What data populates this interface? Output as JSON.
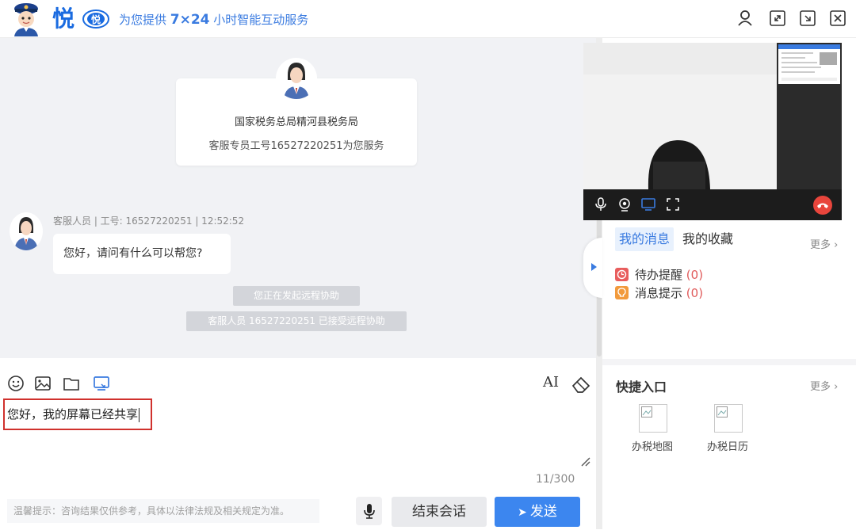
{
  "header": {
    "brand_char": "悦",
    "brand_badge": "悦",
    "slogan_prefix": "为您提供 ",
    "slogan_highlight": "7×24",
    "slogan_suffix": " 小时智能互动服务",
    "accent_color": "#1a6be0"
  },
  "chat": {
    "card": {
      "org": "国家税务总局精河县税务局",
      "service": "客服专员工号16527220251为您服务"
    },
    "message": {
      "meta": "客服人员 | 工号: 16527220251 | 12:52:52",
      "text": "您好，请问有什么可以帮您?"
    },
    "system_notices": [
      "您正在发起远程协助",
      "客服人员 16527220251 已接受远程协助"
    ]
  },
  "input": {
    "typed_text": "您好，我的屏幕已经共享",
    "counter": "11/300",
    "tip": "温馨提示：咨询结果仅供参考，具体以法律法规及相关规定为准。",
    "end_label": "结束会话",
    "send_label": "发送",
    "font_tool_label": "AI"
  },
  "right": {
    "tabs": [
      "我的消息",
      "我的收藏"
    ],
    "more_label": "更多",
    "messages": [
      {
        "label": "待办提醒",
        "count": "(0)",
        "icon": "calendar-icon",
        "color": "#e85d5d"
      },
      {
        "label": "消息提示",
        "count": "(0)",
        "icon": "bulb-icon",
        "color": "#f29a3c"
      }
    ],
    "quick_title": "快捷入口",
    "quick_more": "更多",
    "quick_items": [
      "办税地图",
      "办税日历"
    ]
  }
}
